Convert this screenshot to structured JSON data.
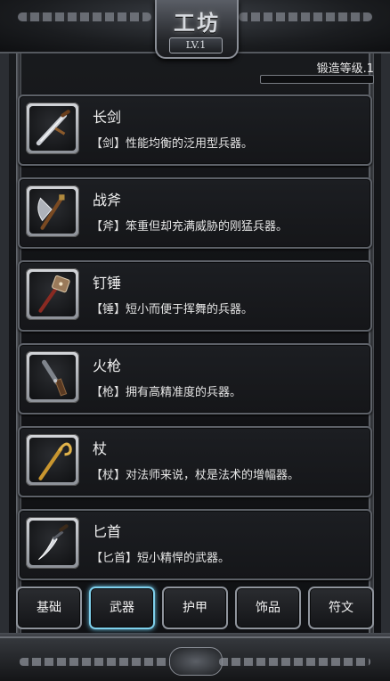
{
  "header": {
    "title": "工坊",
    "level_badge": "LV.1"
  },
  "forge": {
    "label": "锻造等级.1",
    "progress": 0
  },
  "items": [
    {
      "name": "长剑",
      "desc": "【剑】性能均衡的泛用型兵器。",
      "icon": "sword-icon"
    },
    {
      "name": "战斧",
      "desc": "【斧】笨重但却充满威胁的刚猛兵器。",
      "icon": "axe-icon"
    },
    {
      "name": "钉锤",
      "desc": "【锤】短小而便于挥舞的兵器。",
      "icon": "mace-icon"
    },
    {
      "name": "火枪",
      "desc": "【枪】拥有高精准度的兵器。",
      "icon": "musket-icon"
    },
    {
      "name": "杖",
      "desc": "【杖】对法师来说，杖是法术的增幅器。",
      "icon": "staff-icon"
    },
    {
      "name": "匕首",
      "desc": "【匕首】短小精悍的武器。",
      "icon": "dagger-icon"
    }
  ],
  "tabs": [
    {
      "label": "基础",
      "active": false
    },
    {
      "label": "武器",
      "active": true
    },
    {
      "label": "护甲",
      "active": false
    },
    {
      "label": "饰品",
      "active": false
    },
    {
      "label": "符文",
      "active": false
    }
  ],
  "colors": {
    "active_tab_glow": "#7fd0ec",
    "frame_border": "#8f949c"
  }
}
